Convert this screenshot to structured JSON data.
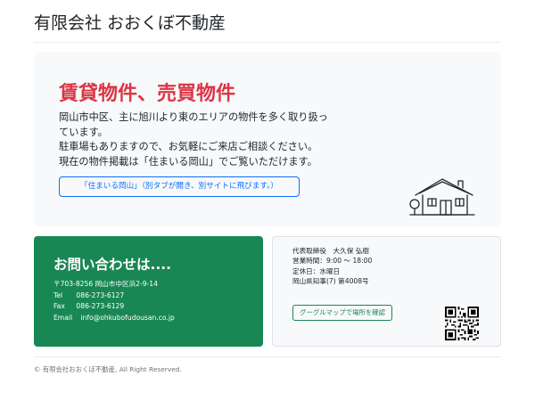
{
  "header": {
    "site_title": "有限会社 おおくぼ不動産"
  },
  "hero": {
    "heading": "賃貸物件、売買物件",
    "lines": [
      "岡山市中区、主に旭川より東のエリアの物件を多く取り扱っ",
      "ています。",
      "駐車場もありますので、お気軽にご来店ご相談ください。",
      "現在の物件掲載は「住まいる岡山」でご覧いただけます。"
    ],
    "button_label": "「住まいる岡山」（別タブが開き、別サイトに飛びます。）"
  },
  "contact": {
    "heading": "お問い合わせは....",
    "address": "〒703-8256 岡山市中区浜2-9-14",
    "tel_label": "Tel",
    "tel": "086-273-6127",
    "fax_label": "Fax",
    "fax": "086-273-6129",
    "email_label": "Email",
    "email": "info@ohkubofudousan.co.jp"
  },
  "info": {
    "lines": [
      "代表取締役　大久保 弘樹",
      "営業時間：9:00 〜 18:00",
      "定休日：水曜日",
      "岡山県知事(7) 第4008号"
    ],
    "map_button_label": "グーグルマップで場所を確認"
  },
  "footer": {
    "copyright": "© 有限会社おおくぼ不動産, All Right Reserved."
  },
  "colors": {
    "accent_red": "#dc3545",
    "primary_blue": "#0d6efd",
    "contact_green": "#198754",
    "panel_gray": "#f8f9fa"
  },
  "icons": {
    "house": "house-outline-icon",
    "qr": "qr-code"
  }
}
